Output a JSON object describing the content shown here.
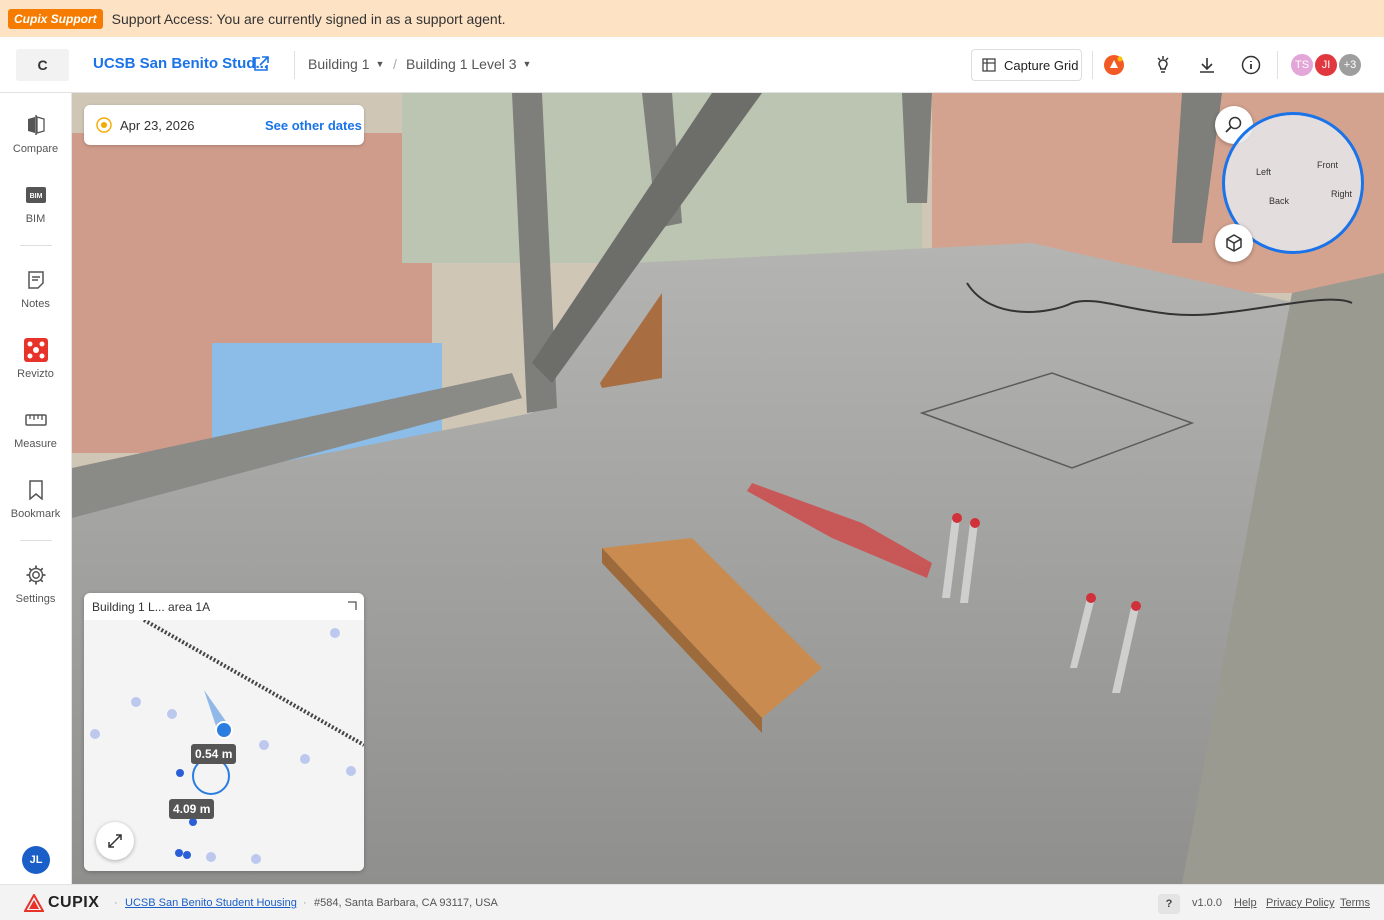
{
  "banner": {
    "tag": "Cupix Support",
    "message": "Support Access: You are currently signed in as a support agent."
  },
  "topbar": {
    "logo_letter": "C",
    "project_name": "UCSB San Benito Stud...",
    "building": "Building 1",
    "separator": "/",
    "level": "Building 1 Level 3",
    "capture_grid_label": "Capture Grid",
    "avatars": [
      {
        "initials": "TS",
        "color": "#e3a6d8"
      },
      {
        "initials": "JI",
        "color": "#e0383e"
      },
      {
        "initials": "+3",
        "color": "#9e9e9e"
      }
    ],
    "accent_color": "#f15a24"
  },
  "sidebar": {
    "items": [
      {
        "label": "Compare",
        "icon": "compare-icon"
      },
      {
        "label": "BIM",
        "icon": "bim-icon"
      },
      {
        "label": "Notes",
        "icon": "notes-icon"
      },
      {
        "label": "Revizto",
        "icon": "revizto-icon"
      },
      {
        "label": "Measure",
        "icon": "ruler-icon"
      },
      {
        "label": "Bookmark",
        "icon": "bookmark-icon"
      },
      {
        "label": "Settings",
        "icon": "gear-icon"
      }
    ],
    "user_initials": "JL"
  },
  "viewer": {
    "date": "Apr 23, 2026",
    "see_other_dates": "See other dates",
    "compass": {
      "left": "Left",
      "front": "Front",
      "back": "Back",
      "right": "Right"
    }
  },
  "minimap": {
    "title": "Building 1 L... area 1A",
    "distance_1": "0.54 m",
    "distance_2": "4.09 m"
  },
  "footer": {
    "brand": "CUPIX",
    "project_link": "UCSB San Benito Student Housing",
    "address": "#584, Santa Barbara, CA 93117, USA",
    "help_q": "?",
    "version": "v1.0.0",
    "help": "Help",
    "privacy": "Privacy Policy",
    "terms": "Terms"
  }
}
